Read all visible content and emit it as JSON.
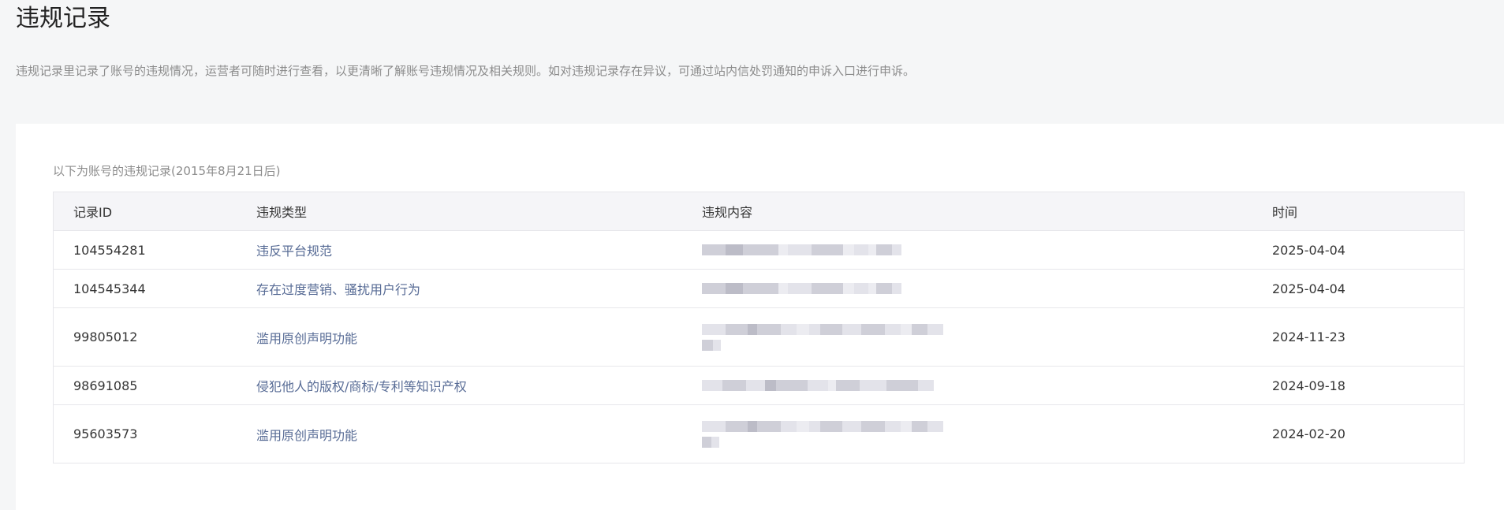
{
  "page": {
    "title": "违规记录",
    "description": "违规记录里记录了账号的违规情况，运营者可随时进行查看，以更清晰了解账号违规情况及相关规则。如对违规记录存在异议，可通过站内信处罚通知的申诉入口进行申诉。"
  },
  "table": {
    "caption": "以下为账号的违规记录(2015年8月21日后)",
    "headers": {
      "id": "记录ID",
      "type": "违规类型",
      "content": "违规内容",
      "time": "时间"
    },
    "rows": [
      {
        "id": "104554281",
        "type": "违反平台规范",
        "time": "2025-04-04"
      },
      {
        "id": "104545344",
        "type": "存在过度营销、骚扰用户行为",
        "time": "2025-04-04"
      },
      {
        "id": "99805012",
        "type": "滥用原创声明功能",
        "time": "2024-11-23"
      },
      {
        "id": "98691085",
        "type": "侵犯他人的版权/商标/专利等知识产权",
        "time": "2024-09-18"
      },
      {
        "id": "95603573",
        "type": "滥用原创声明功能",
        "time": "2024-02-20"
      }
    ]
  },
  "colors": {
    "link": "#576b95",
    "muted_text": "#8c8c8c",
    "border": "#e7e7eb",
    "header_bg": "#f5f5f8"
  }
}
